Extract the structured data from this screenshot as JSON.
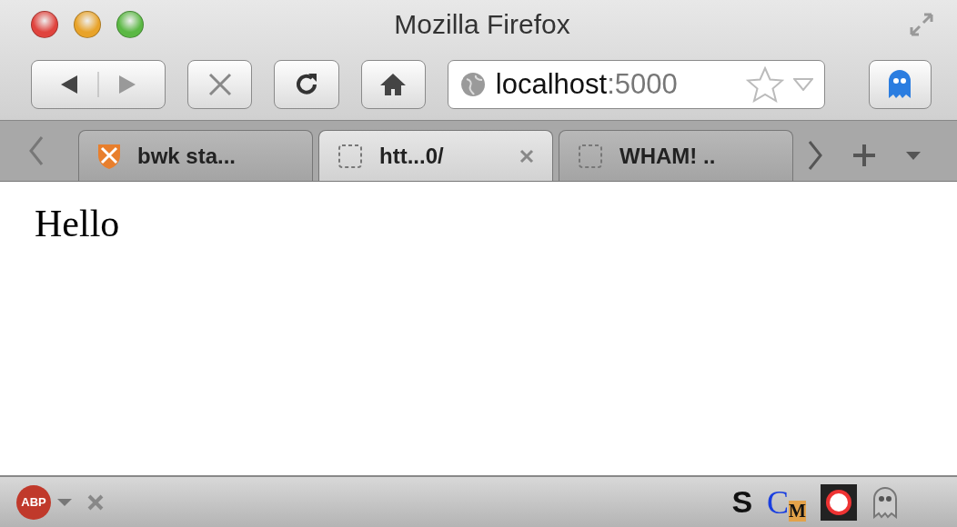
{
  "window": {
    "title": "Mozilla Firefox"
  },
  "address": {
    "host": "localhost",
    "port": ":5000"
  },
  "tabs": [
    {
      "label": "bwk sta...",
      "selected": false,
      "kind": "favicon"
    },
    {
      "label": "htt...0/",
      "selected": true,
      "kind": "blank"
    },
    {
      "label": "WHAM! ..",
      "selected": false,
      "kind": "blank"
    }
  ],
  "page": {
    "text": "Hello"
  },
  "status_bar": {
    "adblock_label": "ABP",
    "addons": [
      {
        "kind": "letter",
        "label": "S"
      },
      {
        "kind": "split",
        "label": "C",
        "sub": "M"
      },
      {
        "kind": "ring"
      },
      {
        "kind": "ghost"
      }
    ]
  }
}
